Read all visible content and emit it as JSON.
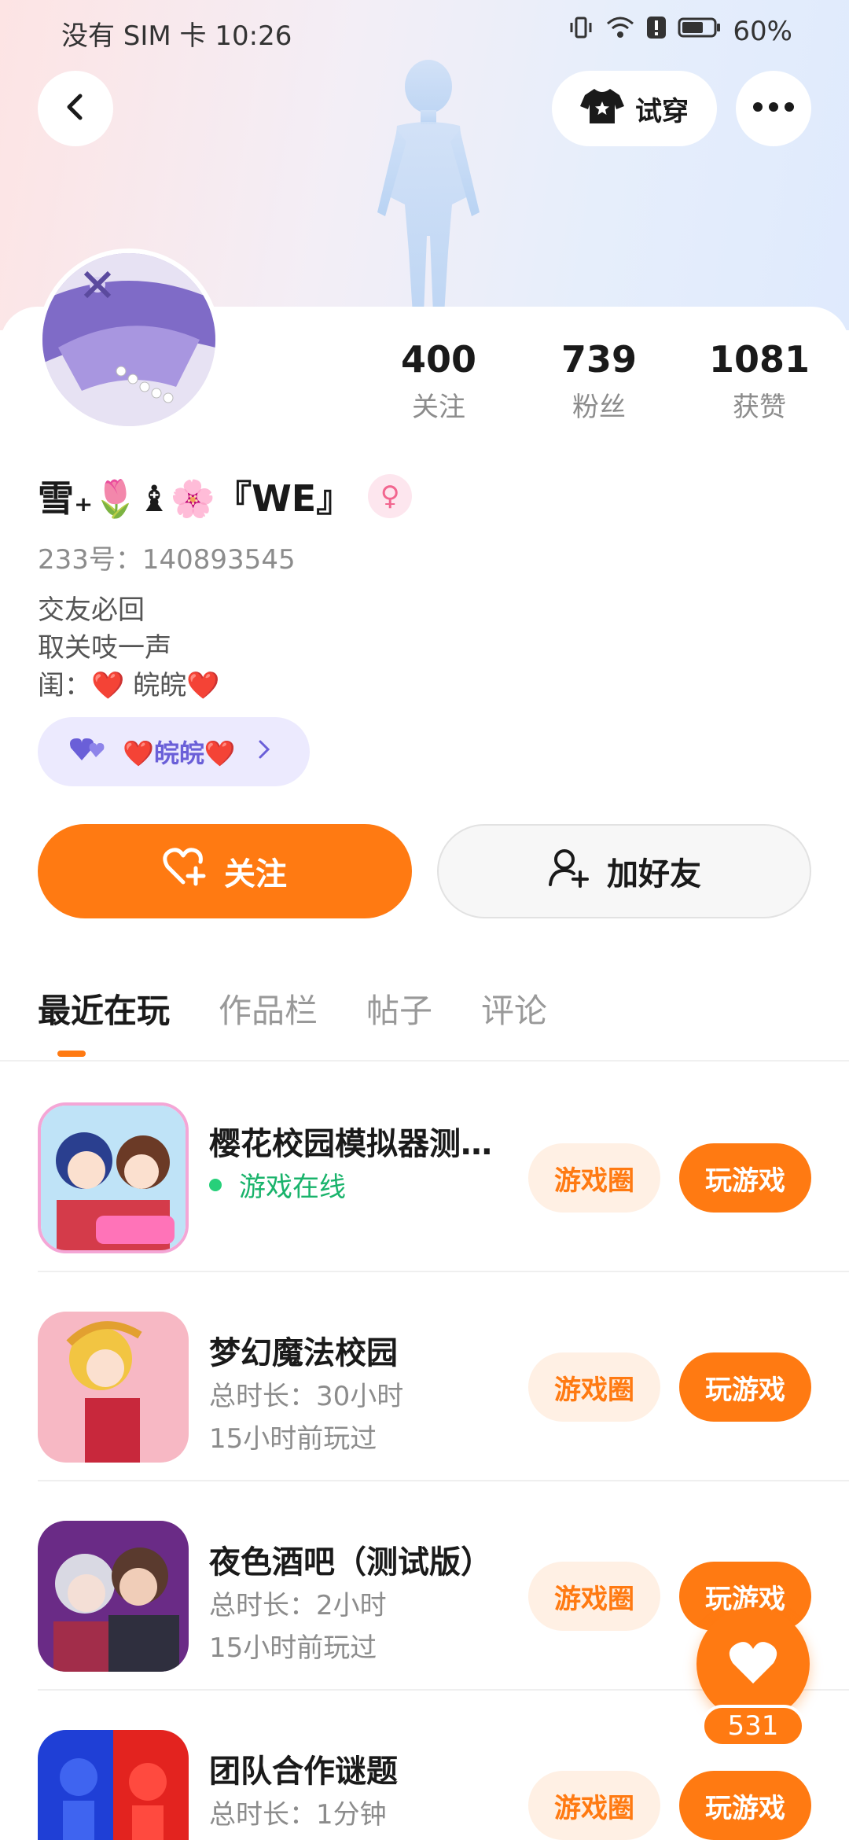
{
  "status_bar": {
    "carrier_time": "没有 SIM 卡 10:26",
    "battery": "60%"
  },
  "header": {
    "tryon_label": "试穿"
  },
  "profile": {
    "following_count": "400",
    "following_label": "关注",
    "followers_count": "739",
    "followers_label": "粉丝",
    "likes_count": "1081",
    "likes_label": "获赞",
    "nickname": "雪₊🌷♝🌸『WE』",
    "uid": "233号：140893545",
    "bio": [
      "交友必回",
      "取关吱一声",
      "闺：❤️ 皖皖❤️"
    ],
    "cp_tag": "❤️皖皖❤️"
  },
  "actions": {
    "follow_label": "关注",
    "add_friend_label": "加好友"
  },
  "tabs": [
    "最近在玩",
    "作品栏",
    "帖子",
    "评论"
  ],
  "games": [
    {
      "title": "樱花校园模拟器测…",
      "status": "游戏在线",
      "circle": "游戏圈",
      "play": "玩游戏"
    },
    {
      "title": "梦幻魔法校园",
      "total": "总时长：30小时",
      "last": "15小时前玩过",
      "circle": "游戏圈",
      "play": "玩游戏"
    },
    {
      "title": "夜色酒吧（测试版）",
      "total": "总时长：2小时",
      "last": "15小时前玩过",
      "circle": "游戏圈",
      "play": "玩游戏"
    },
    {
      "title": "团队合作谜题",
      "total": "总时长：1分钟",
      "circle": "游戏圈",
      "play": "玩游戏"
    }
  ],
  "like_fab": {
    "count": "531"
  },
  "colors": {
    "accent": "#ff7a12",
    "online": "#19b36b",
    "cp_tag_bg": "#eceafe"
  }
}
